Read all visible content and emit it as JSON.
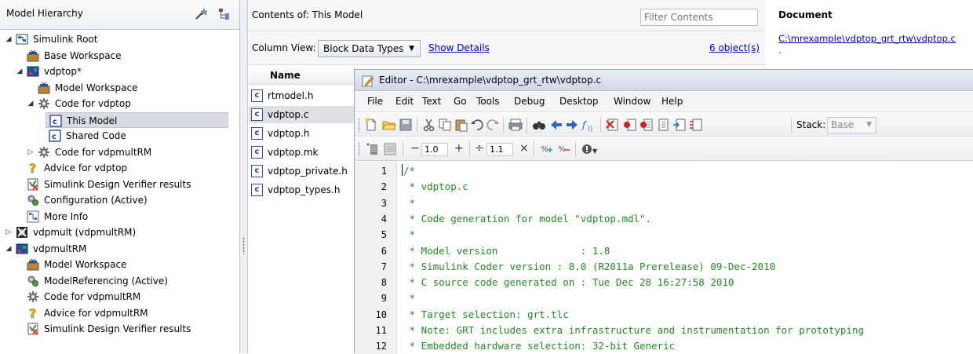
{
  "model_hierarchy": {
    "title": "Model Hierarchy",
    "tree": [
      {
        "label": "Simulink Root",
        "twisty": "◢",
        "icon": "simulink-root-icon"
      },
      {
        "label": "Base Workspace",
        "twisty": "",
        "icon": "workspace-icon"
      },
      {
        "label": "vdptop*",
        "twisty": "◢",
        "icon": "model-icon"
      },
      {
        "label": "Model Workspace",
        "twisty": "",
        "icon": "workspace-icon"
      },
      {
        "label": "Code for vdptop",
        "twisty": "◢",
        "icon": "code-icon"
      },
      {
        "label": "This Model",
        "twisty": "",
        "icon": "c-file-icon"
      },
      {
        "label": "Shared Code",
        "twisty": "",
        "icon": "c-file-icon"
      },
      {
        "label": "Code for vdpmultRM",
        "twisty": "▷",
        "icon": "code-icon"
      },
      {
        "label": "Advice for vdptop",
        "twisty": "",
        "icon": "advice-icon"
      },
      {
        "label": "Simulink Design Verifier results",
        "twisty": "",
        "icon": "verifier-icon"
      },
      {
        "label": "Configuration (Active)",
        "twisty": "",
        "icon": "configuration-icon"
      },
      {
        "label": "More Info",
        "twisty": "",
        "icon": "more-info-icon"
      },
      {
        "label": "vdpmult (vdpmultRM)",
        "twisty": "▷",
        "icon": "model-reference-icon"
      },
      {
        "label": "vdpmultRM",
        "twisty": "◢",
        "icon": "model-icon"
      },
      {
        "label": "Model Workspace",
        "twisty": "",
        "icon": "workspace-icon"
      },
      {
        "label": "ModelReferencing (Active)",
        "twisty": "",
        "icon": "configuration-icon"
      },
      {
        "label": "Code for vdpmultRM",
        "twisty": "",
        "icon": "code-icon"
      },
      {
        "label": "Advice for vdpmultRM",
        "twisty": "",
        "icon": "advice-icon"
      },
      {
        "label": "Simulink Design Verifier results",
        "twisty": "",
        "icon": "verifier-icon"
      }
    ]
  },
  "contents": {
    "label": "Contents of:  This Model",
    "filter_placeholder": "Filter Contents",
    "column_view_label": "Column View:",
    "column_view_value": "Block Data Types",
    "show_details": "Show Details",
    "object_count": "6 object(s)",
    "name_header": "Name",
    "files": [
      "rtmodel.h",
      "vdptop.c",
      "vdptop.h",
      "vdptop.mk",
      "vdptop_private.h",
      "vdptop_types.h"
    ],
    "file_icon_glyph": "c"
  },
  "document": {
    "title": "Document",
    "link": "C:\\mrexample\\vdptop_grt_rtw\\vdptop.c",
    "link_continuation": "."
  },
  "editor": {
    "title": "Editor - C:\\mrexample\\vdptop_grt_rtw\\vdptop.c",
    "menu": [
      "File",
      "Edit",
      "Text",
      "Go",
      "Tools",
      "Debug",
      "Desktop",
      "Window",
      "Help"
    ],
    "stack_label": "Stack:",
    "stack_value": "Base",
    "cell_value_1": "1.0",
    "cell_value_2": "1.1",
    "lines": [
      {
        "no": "1",
        "text": "/*"
      },
      {
        "no": "2",
        "text": " * vdptop.c"
      },
      {
        "no": "3",
        "text": " *"
      },
      {
        "no": "4",
        "text": " * Code generation for model \"vdptop.mdl\"."
      },
      {
        "no": "5",
        "text": " *"
      },
      {
        "no": "6",
        "text": " * Model version              : 1.8"
      },
      {
        "no": "7",
        "text": " * Simulink Coder version : 8.0 (R2011a Prerelease) 09-Dec-2010"
      },
      {
        "no": "8",
        "text": " * C source code generated on : Tue Dec 28 16:27:58 2010"
      },
      {
        "no": "9",
        "text": " *"
      },
      {
        "no": "10",
        "text": " * Target selection: grt.tlc"
      },
      {
        "no": "11",
        "text": " * Note: GRT includes extra infrastructure and instrumentation for prototyping"
      },
      {
        "no": "12",
        "text": " * Embedded hardware selection: 32-bit Generic"
      }
    ],
    "comment_color": "#228b22"
  }
}
